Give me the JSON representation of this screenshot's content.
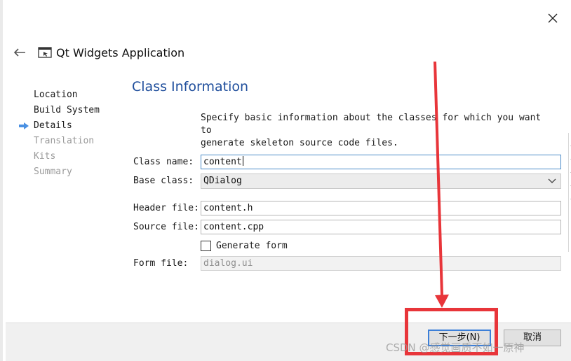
{
  "wizard": {
    "title": "Qt Widgets Application"
  },
  "steps": [
    {
      "label": "Location",
      "state": "done"
    },
    {
      "label": "Build System",
      "state": "done"
    },
    {
      "label": "Details",
      "state": "current"
    },
    {
      "label": "Translation",
      "state": "pending"
    },
    {
      "label": "Kits",
      "state": "pending"
    },
    {
      "label": "Summary",
      "state": "pending"
    }
  ],
  "page": {
    "title": "Class Information",
    "description_line1": "Specify basic information about the classes for which you want to",
    "description_line2": "generate skeleton source code files."
  },
  "form": {
    "class_name_label": "Class name:",
    "class_name_value": "content",
    "base_class_label": "Base class:",
    "base_class_value": "QDialog",
    "header_file_label": "Header file:",
    "header_file_value": "content.h",
    "source_file_label": "Source file:",
    "source_file_value": "content.cpp",
    "generate_form_label": "Generate form",
    "generate_form_checked": false,
    "form_file_label": "Form file:",
    "form_file_value": "dialog.ui"
  },
  "buttons": {
    "next_label": "下一步(N)",
    "cancel_label": "取消"
  },
  "annotation": {
    "color": "#e8353a"
  },
  "watermark": {
    "text": "CSDN @感觉画质不如一原神"
  },
  "colors": {
    "title_blue": "#1f4e9c",
    "focus_blue": "#4b8bc8",
    "step_arrow_blue": "#4a90e2"
  }
}
